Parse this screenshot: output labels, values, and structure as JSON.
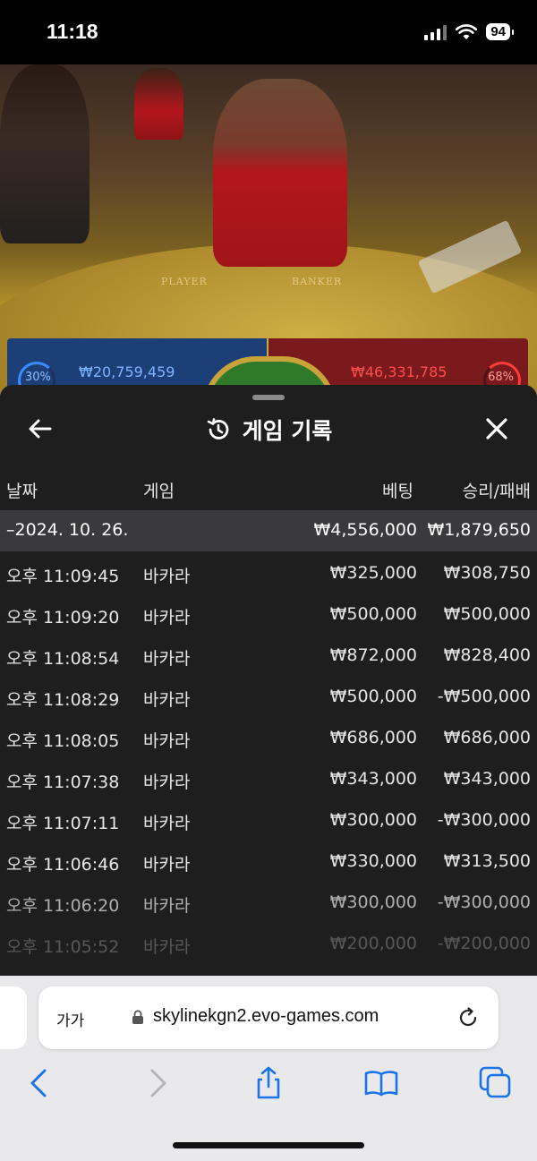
{
  "status_bar": {
    "time": "11:18",
    "battery": "94"
  },
  "video": {
    "felt_player": "PLAYER",
    "felt_banker": "BANKER",
    "player_stat": {
      "percent": "30%",
      "amount": "₩20,759,459"
    },
    "banker_stat": {
      "percent": "68%",
      "amount": "₩46,331,785"
    }
  },
  "sheet": {
    "title": "게임 기록",
    "columns": {
      "date": "날짜",
      "game": "게임",
      "bet": "베팅",
      "win_loss": "승리/패배"
    },
    "date_group": {
      "label": "–2024. 10. 26.",
      "bet_total": "₩4,556,000",
      "win_total": "₩1,879,650"
    },
    "rows": [
      {
        "time": "오후 11:09:45",
        "game": "바카라",
        "bet": "₩325,000",
        "win": "₩308,750"
      },
      {
        "time": "오후 11:09:20",
        "game": "바카라",
        "bet": "₩500,000",
        "win": "₩500,000"
      },
      {
        "time": "오후 11:08:54",
        "game": "바카라",
        "bet": "₩872,000",
        "win": "₩828,400"
      },
      {
        "time": "오후 11:08:29",
        "game": "바카라",
        "bet": "₩500,000",
        "win": "-₩500,000"
      },
      {
        "time": "오후 11:08:05",
        "game": "바카라",
        "bet": "₩686,000",
        "win": "₩686,000"
      },
      {
        "time": "오후 11:07:38",
        "game": "바카라",
        "bet": "₩343,000",
        "win": "₩343,000"
      },
      {
        "time": "오후 11:07:11",
        "game": "바카라",
        "bet": "₩300,000",
        "win": "-₩300,000"
      },
      {
        "time": "오후 11:06:46",
        "game": "바카라",
        "bet": "₩330,000",
        "win": "₩313,500"
      },
      {
        "time": "오후 11:06:20",
        "game": "바카라",
        "bet": "₩300,000",
        "win": "-₩300,000"
      },
      {
        "time": "오후 11:05:52",
        "game": "바카라",
        "bet": "₩200,000",
        "win": "-₩200,000"
      }
    ]
  },
  "browser": {
    "text_size_label": "가가",
    "url": "skylinekgn2.evo-games.com"
  },
  "colors": {
    "accent_blue": "#1a73e8",
    "sheet_bg": "#1e1e1f",
    "date_row_bg": "#3a3a3c"
  }
}
